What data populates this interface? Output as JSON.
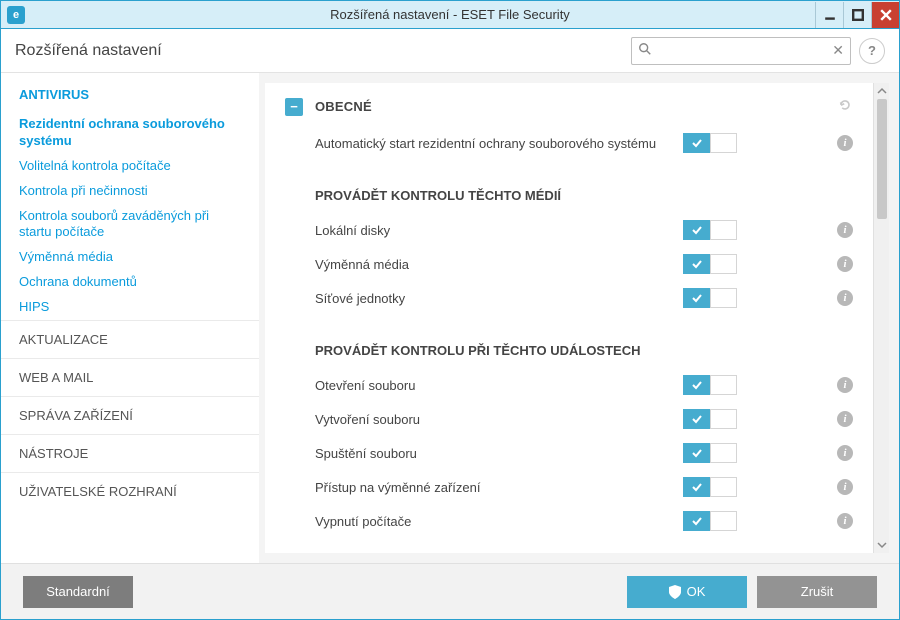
{
  "window": {
    "title": "Rozšířená nastavení - ESET File Security",
    "badge": "e"
  },
  "header": {
    "title": "Rozšířená nastavení"
  },
  "search": {
    "placeholder": ""
  },
  "sidebar": {
    "top_section": "ANTIVIRUS",
    "subs": [
      "Rezidentní ochrana souborového systému",
      "Volitelná kontrola počítače",
      "Kontrola při nečinnosti",
      "Kontrola souborů zaváděných při startu počítače",
      "Výměnná média",
      "Ochrana dokumentů",
      "HIPS"
    ],
    "cats": [
      "AKTUALIZACE",
      "WEB A MAIL",
      "SPRÁVA ZAŘÍZENÍ",
      "NÁSTROJE",
      "UŽIVATELSKÉ ROZHRANÍ"
    ]
  },
  "content": {
    "group1": {
      "title": "OBECNÉ"
    },
    "rows_top": [
      {
        "label": "Automatický start rezidentní ochrany souborového systému",
        "on": true
      }
    ],
    "subhead_media": "PROVÁDĚT KONTROLU TĚCHTO MÉDIÍ",
    "rows_media": [
      {
        "label": "Lokální disky",
        "on": true
      },
      {
        "label": "Výměnná média",
        "on": true
      },
      {
        "label": "Síťové jednotky",
        "on": true
      }
    ],
    "subhead_events": "PROVÁDĚT KONTROLU PŘI TĚCHTO UDÁLOSTECH",
    "rows_events": [
      {
        "label": "Otevření souboru",
        "on": true
      },
      {
        "label": "Vytvoření souboru",
        "on": true
      },
      {
        "label": "Spuštění souboru",
        "on": true
      },
      {
        "label": "Přístup na výměnné zařízení",
        "on": true
      },
      {
        "label": "Vypnutí počítače",
        "on": true
      }
    ]
  },
  "footer": {
    "default": "Standardní",
    "ok": "OK",
    "cancel": "Zrušit"
  },
  "chart_data": null
}
